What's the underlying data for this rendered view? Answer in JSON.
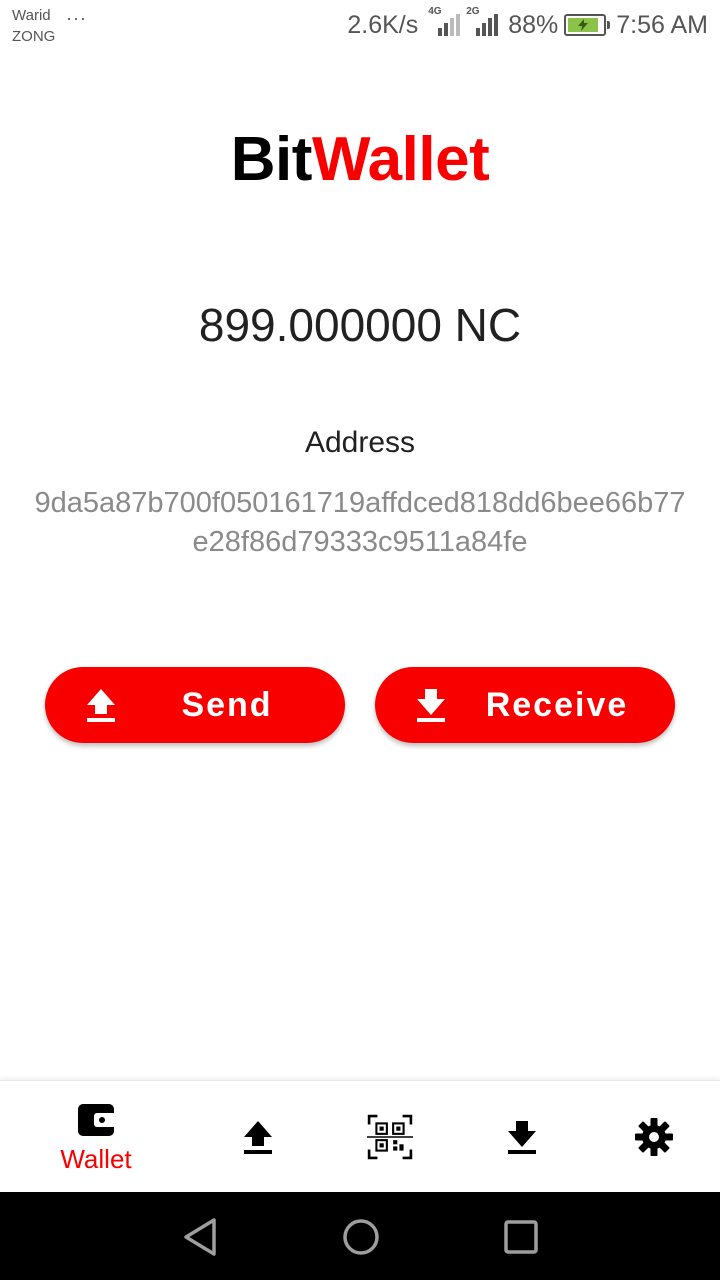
{
  "status_bar": {
    "carrier_1": "Warid",
    "carrier_2": "ZONG",
    "more": "···",
    "net_speed": "2.6K/s",
    "sim1_tag": "4G",
    "sim2_tag": "2G",
    "battery": "88%",
    "battery_level": 0.88,
    "time": "7:56 AM"
  },
  "header": {
    "title_part1": "Bit",
    "title_part2": "Wallet",
    "accent_color": "#f90000"
  },
  "wallet": {
    "balance": "899.000000 NC",
    "address_label": "Address",
    "address": "9da5a87b700f050161719affdced818dd6bee66b77e28f86d79333c9511a84fe"
  },
  "actions": {
    "send_label": "Send",
    "send_icon": "upload-icon",
    "receive_label": "Receive",
    "receive_icon": "download-icon"
  },
  "bottom_nav": {
    "items": [
      {
        "label": "Wallet",
        "icon": "wallet-icon",
        "active": true
      },
      {
        "label": "",
        "icon": "send-icon",
        "active": false
      },
      {
        "label": "",
        "icon": "qr-scan-icon",
        "active": false
      },
      {
        "label": "",
        "icon": "receive-icon",
        "active": false
      },
      {
        "label": "",
        "icon": "settings-gear-icon",
        "active": false
      }
    ]
  },
  "system_nav": {
    "buttons": [
      "back-icon",
      "home-icon",
      "recents-icon"
    ]
  }
}
